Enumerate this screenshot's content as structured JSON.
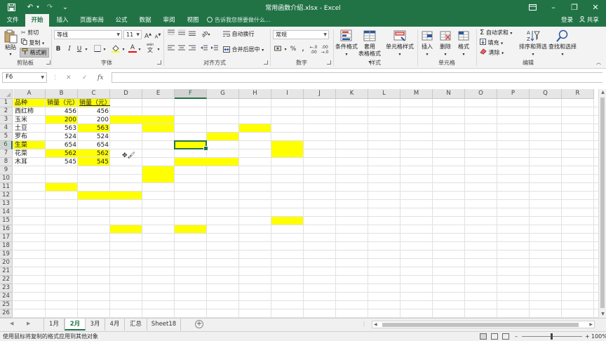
{
  "titlebar": {
    "title": "常用函数介绍.xlsx - Excel",
    "save_glyph": "💾",
    "undo_glyph": "↶",
    "redo_glyph": "↷",
    "customize_glyph": "⌄",
    "ribbon_opts_glyph": "▣",
    "minimize_glyph": "–",
    "restore_glyph": "❐",
    "close_glyph": "✕"
  },
  "tabs": {
    "items": [
      "文件",
      "开始",
      "插入",
      "页面布局",
      "公式",
      "数据",
      "审阅",
      "视图"
    ],
    "active": "开始",
    "tellme": "告诉我您想要做什么...",
    "login": "登录",
    "share": "共享"
  },
  "ribbon": {
    "clipboard": {
      "paste": "粘贴",
      "cut": "剪切",
      "copy": "复制",
      "format_painter": "格式刷",
      "label": "剪贴板"
    },
    "font": {
      "name": "等线",
      "size": "11",
      "bold": "B",
      "italic": "I",
      "underline": "U",
      "grow": "A",
      "shrink": "A",
      "wen": "wén",
      "label": "字体"
    },
    "alignment": {
      "wrap": "自动换行",
      "merge": "合并后居中",
      "label": "对齐方式"
    },
    "number": {
      "format": "常规",
      "percent": "%",
      "comma": ",",
      "label": "数字"
    },
    "styles": {
      "conditional": "条件格式",
      "table_line1": "套用",
      "table_line2": "表格格式",
      "cell_styles": "单元格样式",
      "label": "样式"
    },
    "cells": {
      "insert": "插入",
      "delete": "删除",
      "format": "格式",
      "label": "单元格"
    },
    "editing": {
      "autosum": "自动求和",
      "fill": "填充",
      "clear": "清除",
      "sort_filter": "排序和筛选",
      "find_select": "查找和选择",
      "label": "编辑"
    }
  },
  "formula_bar": {
    "name_box": "F6",
    "cancel": "✕",
    "enter": "✓",
    "fx": "fx",
    "value": ""
  },
  "colors": {
    "accent": "#217346",
    "highlight": "#ffff00"
  },
  "grid": {
    "columns": [
      "A",
      "B",
      "C",
      "D",
      "E",
      "F",
      "G",
      "H",
      "I",
      "J",
      "K",
      "L",
      "M",
      "N",
      "O",
      "P",
      "Q",
      "R"
    ],
    "rows": [
      1,
      2,
      3,
      4,
      5,
      6,
      7,
      8,
      9,
      10,
      11,
      12,
      13,
      14,
      15,
      16,
      17,
      18,
      19,
      20,
      21,
      22,
      23,
      24,
      25,
      26
    ],
    "selected_cell": "F6",
    "header": {
      "a1": "品种",
      "b1": "销量（元）",
      "c1": "销量（元）"
    },
    "data_rows": [
      {
        "a": "西红柿",
        "b": "456",
        "c": "456"
      },
      {
        "a": "玉米",
        "b": "200",
        "c": "200"
      },
      {
        "a": "土豆",
        "b": "563",
        "c": "563"
      },
      {
        "a": "罗布",
        "b": "524",
        "c": "524"
      },
      {
        "a": "生菜",
        "b": "654",
        "c": "654"
      },
      {
        "a": "花菜",
        "b": "562",
        "c": "562"
      },
      {
        "a": "木耳",
        "b": "545",
        "c": "545"
      }
    ],
    "cursor_glyph": "✥🖌"
  },
  "sheets": {
    "tabs": [
      "1月",
      "2月",
      "3月",
      "4月",
      "汇总",
      "Sheet18"
    ],
    "active": "2月",
    "add": "+"
  },
  "status": {
    "message": "使用鼠标将复制的格式应用到其他对象",
    "zoom": "100%",
    "zoom_minus": "–",
    "zoom_plus": "+"
  }
}
